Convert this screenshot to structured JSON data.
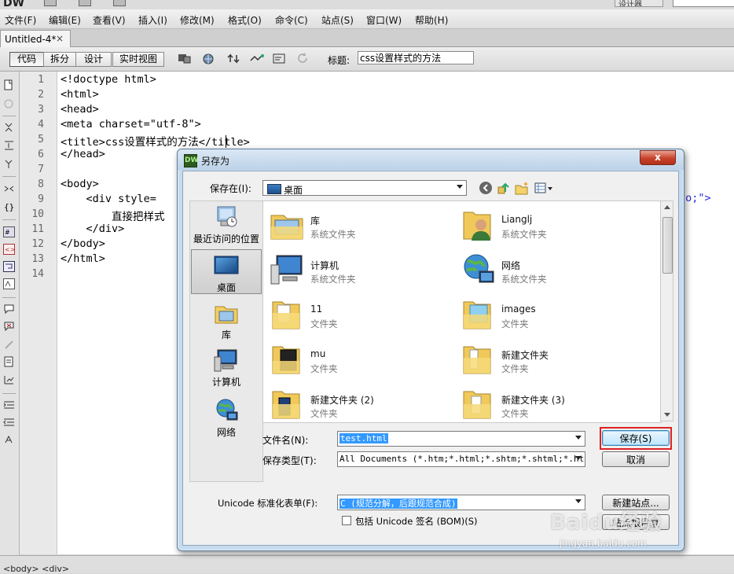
{
  "app": {
    "logo": "DW",
    "designer_label": "设计器",
    "menus": [
      "文件(F)",
      "编辑(E)",
      "查看(V)",
      "插入(I)",
      "修改(M)",
      "格式(O)",
      "命令(C)",
      "站点(S)",
      "窗口(W)",
      "帮助(H)"
    ]
  },
  "document_tab": {
    "label": "Untitled-4*",
    "close": "×"
  },
  "doc_toolbar": {
    "views": [
      "代码",
      "拆分",
      "设计",
      "实时视图"
    ],
    "active_view": "代码",
    "title_label": "标题:",
    "title_value": "css设置样式的方法"
  },
  "editor": {
    "line_numbers": [
      "1",
      "2",
      "3",
      "4",
      "5",
      "6",
      "7",
      "8",
      "9",
      "10",
      "11",
      "12",
      "13",
      "14"
    ],
    "lines": [
      "<!doctype html>",
      "<html>",
      "<head>",
      "<meta charset=\"utf-8\">",
      "<title>css设置样式的方法</title>",
      "</head>",
      "",
      "<body>",
      "    <div style=",
      "        直接把样式",
      "    </div>",
      "</body>",
      "</html>",
      ""
    ],
    "line9_tail": "to;\">",
    "status_text": "<body> <div>"
  },
  "dialog": {
    "title": "另存为",
    "close_label": "x",
    "save_in_label": "保存在(I):",
    "save_in_value": "桌面",
    "places": [
      {
        "label": "最近访问的位置",
        "icon": "recent-places-icon"
      },
      {
        "label": "桌面",
        "icon": "desktop-icon"
      },
      {
        "label": "库",
        "icon": "library-icon"
      },
      {
        "label": "计算机",
        "icon": "computer-icon"
      },
      {
        "label": "网络",
        "icon": "network-icon"
      }
    ],
    "selected_place": "桌面",
    "files": [
      {
        "name": "库",
        "type": "系统文件夹",
        "icon": "library-folder-icon"
      },
      {
        "name": "Lianglj",
        "type": "系统文件夹",
        "icon": "user-folder-icon"
      },
      {
        "name": "计算机",
        "type": "系统文件夹",
        "icon": "computer-icon"
      },
      {
        "name": "网络",
        "type": "系统文件夹",
        "icon": "network-icon"
      },
      {
        "name": "11",
        "type": "文件夹",
        "icon": "folder-icon"
      },
      {
        "name": "images",
        "type": "文件夹",
        "icon": "folder-icon"
      },
      {
        "name": "mu",
        "type": "文件夹",
        "icon": "folder-icon"
      },
      {
        "name": "新建文件夹",
        "type": "文件夹",
        "icon": "folder-icon"
      },
      {
        "name": "新建文件夹 (2)",
        "type": "文件夹",
        "icon": "folder-icon"
      },
      {
        "name": "新建文件夹 (3)",
        "type": "文件夹",
        "icon": "folder-icon"
      }
    ],
    "filename_label": "文件名(N):",
    "filename_value": "test.html",
    "filetype_label": "保存类型(T):",
    "filetype_value": "All Documents (*.htm;*.html;*.shtm;*.shtml;*.hta;",
    "unicode_label": "Unicode 标准化表单(F):",
    "unicode_value": "C (规范分解，后跟规范合成)",
    "bom_label": "包括 Unicode 签名 (BOM)(S)",
    "bom_checked": false,
    "save_button": "保存(S)",
    "cancel_button": "取消",
    "new_site_button": "新建站点...",
    "site_root_button": "站点根目录"
  },
  "watermark": {
    "brand": "Baidu经验",
    "url": "jingyan.baidu.com"
  },
  "colors": {
    "highlight_border": "#dd2222",
    "selection": "#3399ff",
    "dialog_frame": "#c6dbef"
  }
}
